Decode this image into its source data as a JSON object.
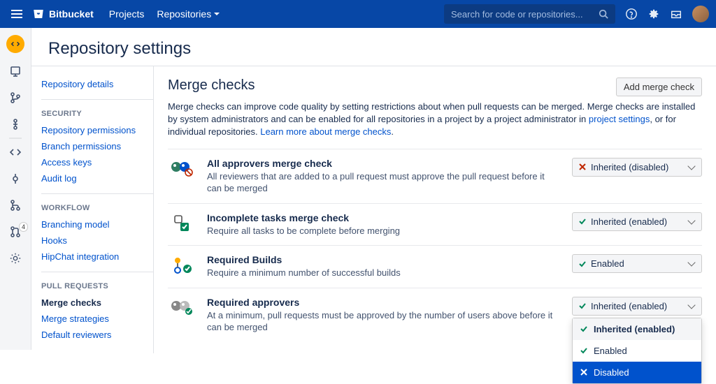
{
  "topbar": {
    "logo_text": "Bitbucket",
    "nav": {
      "projects": "Projects",
      "repositories": "Repositories"
    },
    "search_placeholder": "Search for code or repositories..."
  },
  "header": {
    "title": "Repository settings"
  },
  "sidebar": {
    "repo_details": "Repository details",
    "sec_header": "SECURITY",
    "sec": {
      "repo_perms": "Repository permissions",
      "branch_perms": "Branch permissions",
      "access_keys": "Access keys",
      "audit_log": "Audit log"
    },
    "wf_header": "WORKFLOW",
    "wf": {
      "branching": "Branching model",
      "hooks": "Hooks",
      "hipchat": "HipChat integration"
    },
    "pr_header": "PULL REQUESTS",
    "pr": {
      "merge_checks": "Merge checks",
      "merge_strategies": "Merge strategies",
      "default_reviewers": "Default reviewers"
    }
  },
  "content": {
    "title": "Merge checks",
    "add_btn": "Add merge check",
    "intro_1": "Merge checks can improve code quality by setting restrictions about when pull requests can be merged. Merge checks are installed by system administrators and can be enabled for all repositories in a project by a project administrator in ",
    "project_settings": "project settings",
    "intro_2": ", or for individual repositories. ",
    "learn_more": "Learn more about merge checks",
    "checks": [
      {
        "title": "All approvers merge check",
        "desc": "All reviewers that are added to a pull request must approve the pull request before it can be merged",
        "state": "Inherited (disabled)",
        "icon": "cross"
      },
      {
        "title": "Incomplete tasks merge check",
        "desc": "Require all tasks to be complete before merging",
        "state": "Inherited (enabled)",
        "icon": "check"
      },
      {
        "title": "Required Builds",
        "desc": "Require a minimum number of successful builds",
        "state": "Enabled",
        "icon": "check"
      },
      {
        "title": "Required approvers",
        "desc": "At a minimum, pull requests must be approved by the number of users above before it can be merged",
        "state": "Inherited (enabled)",
        "icon": "check"
      }
    ],
    "menu": {
      "inherited_enabled": "Inherited (enabled)",
      "enabled": "Enabled",
      "disabled": "Disabled"
    }
  },
  "rail_badge": "4"
}
